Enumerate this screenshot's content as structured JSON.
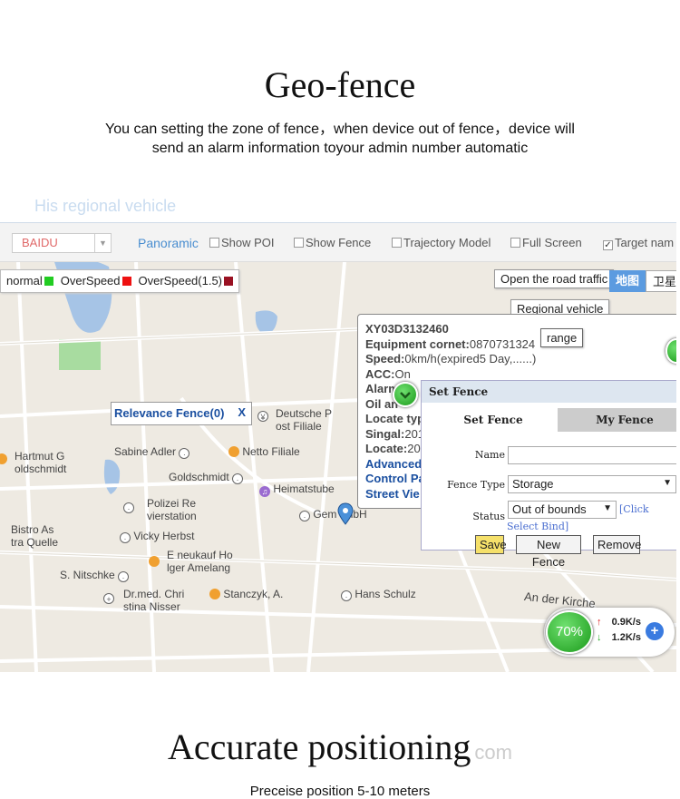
{
  "heading": "Geo-fence",
  "description": {
    "line1": "You can setting the zone of fence，when device out of fence，device will",
    "line2": "send an alarm information toyour admin number automatic"
  },
  "app": {
    "title": "His regional vehicle",
    "toolbar": {
      "map_source": "BAIDU",
      "panoramic": "Panoramic",
      "show_poi": "Show POI",
      "show_fence": "Show Fence",
      "trajectory_model": "Trajectory Model",
      "full_screen": "Full Screen",
      "target_name": "Target nam"
    },
    "legend": {
      "normal": "normal",
      "overspeed": "OverSpeed",
      "overspeed_15": "OverSpeed(1.5)",
      "colors": {
        "normal": "#22cc22",
        "overspeed": "#ee1111",
        "overspeed_15": "#991122"
      }
    },
    "buttons": {
      "road_traffic": "Open the road traffic",
      "regional_vehicle": "Regional vehicle",
      "range": "range",
      "map_type_map": "地图",
      "map_type_satellite": "卫星"
    },
    "relevance_fence": {
      "label": "Relevance Fence(0)",
      "close": "X"
    },
    "pois": {
      "deutsche_post_1": "Deutsche P",
      "deutsche_post_2": "ost Filiale",
      "hartmut_1": "Hartmut G",
      "hartmut_2": "oldschmidt",
      "sabine": "Sabine Adler",
      "netto": "Netto Filiale",
      "goldschmidt": "Goldschmidt",
      "heimatstube": "Heimatstube",
      "polizei_1": "Polizei Re",
      "polizei_2": "vierstation",
      "gem": "Gem",
      "gmbh": "mbH",
      "bistro_1": "Bistro As",
      "bistro_2": "tra Quelle",
      "vicky": "Vicky Herbst",
      "eneukauf_1": "E neukauf Ho",
      "eneukauf_2": "lger Amelang",
      "nitschke": "S. Nitschke",
      "drmed_1": "Dr.med. Chri",
      "drmed_2": "stina Nisser",
      "stanczyk": "Stanczyk, A.",
      "hans": "Hans Schulz",
      "kirche": "An der Kirche"
    },
    "info": {
      "device_id": "XY03D3132460",
      "equipment_label": "Equipment cornet:",
      "equipment_value": "0870731324",
      "speed_label": "Speed:",
      "speed_value": "0km/h(expired5 Day,......)",
      "acc_label": "ACC:",
      "acc_value": "On",
      "alarm_label": "Alarm",
      "oil_label": "Oil an",
      "locate_type_label": "Locate typ",
      "signal_label": "Singal:",
      "signal_value": "201",
      "locate_label": "Locate:",
      "locate_value": "20",
      "link_advanced": "Advanced",
      "link_control": "Control Pa",
      "link_street": "Street Vie"
    },
    "set_fence": {
      "title": "Set Fence",
      "tab_set": "Set Fence",
      "tab_my": "My Fence",
      "name_label": "Name",
      "name_value": "",
      "fence_type_label": "Fence Type",
      "fence_type_value": "Storage",
      "status_label": "Status",
      "status_value": "Out of bounds",
      "click_select_bind_1": "[Click",
      "click_select_bind_2": "Select Bind]",
      "save": "Save",
      "new_fence": "New Fence",
      "remove": "Remove"
    },
    "speed_widget": {
      "percent": "70%",
      "up": "0.9K/s",
      "down": "1.2K/s",
      "up_color": "#dd2222",
      "down_color": "#22aa22"
    }
  },
  "heading2": "Accurate positioning",
  "heading2_watermark": "com",
  "subheading2": "Preceise position 5-10 meters"
}
